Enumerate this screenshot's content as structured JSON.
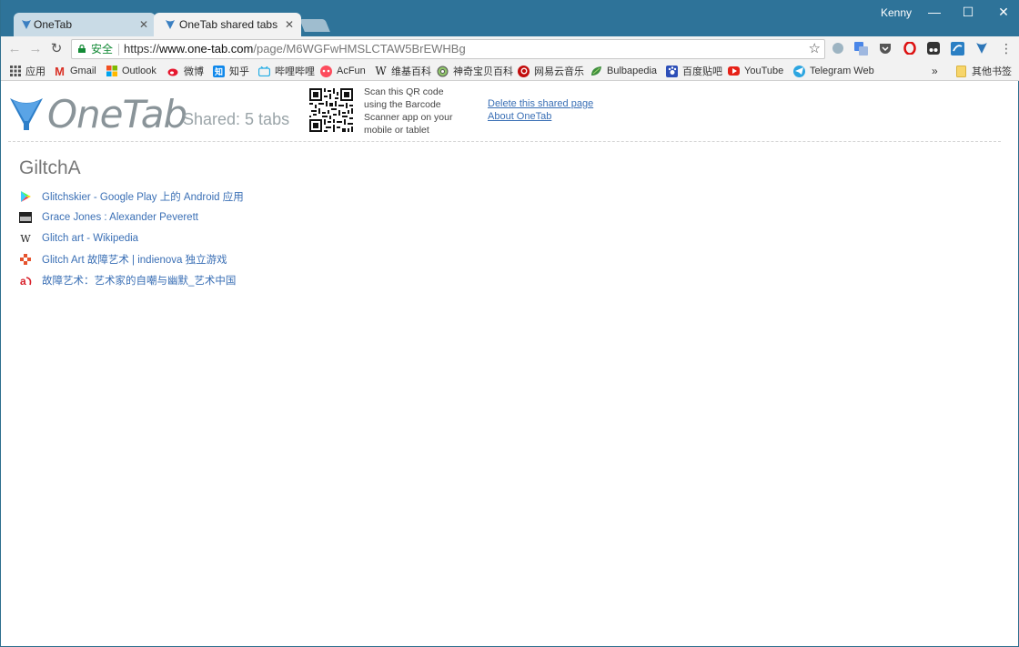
{
  "browser": {
    "tabs": [
      {
        "title": "OneTab",
        "active": false
      },
      {
        "title": "OneTab shared tabs",
        "active": true
      }
    ],
    "user": "Kenny",
    "window_controls": {
      "minimize": "—",
      "maximize": "☐",
      "close": "✕"
    },
    "omnibox": {
      "security_label": "安全",
      "url_scheme": "https://",
      "url_host": "www.one-tab.com",
      "url_path": "/page/M6WGFwHMSLCTAW5BrEWHBg"
    },
    "bookmarks": [
      {
        "label": "应用",
        "icon": "apps-grid-icon"
      },
      {
        "label": "Gmail",
        "icon": "gmail-icon"
      },
      {
        "label": "Outlook",
        "icon": "outlook-icon"
      },
      {
        "label": "微博",
        "icon": "weibo-icon"
      },
      {
        "label": "知乎",
        "icon": "zhihu-icon"
      },
      {
        "label": "哔哩哔哩",
        "icon": "bilibili-icon"
      },
      {
        "label": "AcFun",
        "icon": "acfun-icon"
      },
      {
        "label": "维基百科",
        "icon": "wikipedia-icon"
      },
      {
        "label": "神奇宝贝百科",
        "icon": "pokemon-wiki-icon"
      },
      {
        "label": "网易云音乐",
        "icon": "netease-music-icon"
      },
      {
        "label": "Bulbapedia",
        "icon": "bulbapedia-icon"
      },
      {
        "label": "百度贴吧",
        "icon": "baidu-tieba-icon"
      },
      {
        "label": "YouTube",
        "icon": "youtube-icon"
      },
      {
        "label": "Telegram Web",
        "icon": "telegram-icon"
      }
    ],
    "bookmarks_overflow": "»",
    "other_bookmarks": "其他书签"
  },
  "page": {
    "logo_text": "OneTab",
    "shared_count": "Shared: 5 tabs",
    "qr_caption": "Scan this QR code using the Barcode Scanner app on your mobile or tablet",
    "delete_link": "Delete this shared page",
    "about_link": "About OneTab",
    "group_title": "GiltchA",
    "links": [
      {
        "title": "Glitchskier - Google Play 上的 Android 应用",
        "icon": "google-play-icon"
      },
      {
        "title": "Grace Jones : Alexander Peverett",
        "icon": "page-thumbnail-icon"
      },
      {
        "title": "Glitch art - Wikipedia",
        "icon": "wikipedia-icon"
      },
      {
        "title": "Glitch Art 故障艺术 | indienova 独立游戏",
        "icon": "indienova-icon"
      },
      {
        "title": "故障艺术：艺术家的自嘲与幽默_艺术中国",
        "icon": "art-china-icon"
      }
    ]
  },
  "colors": {
    "titlebar": "#2e7399",
    "link": "#3a6fb5",
    "secure": "#138a36"
  }
}
